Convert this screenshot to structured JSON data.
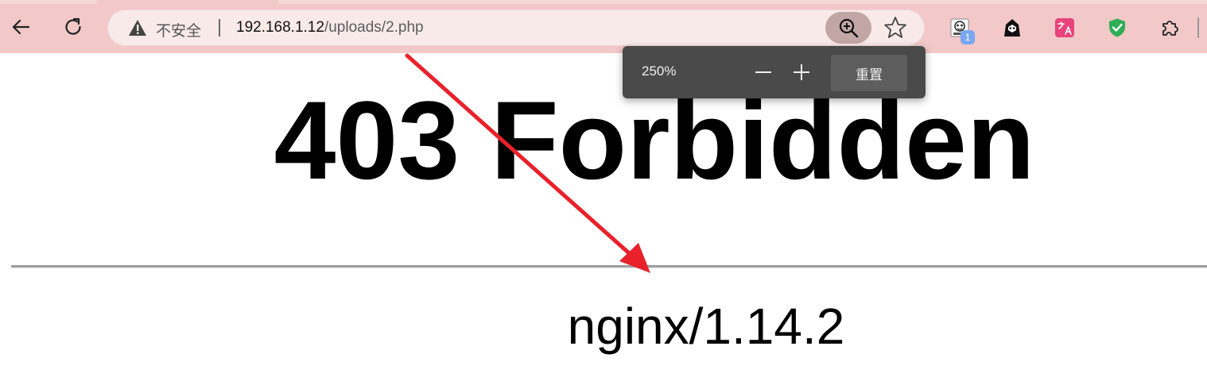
{
  "browser": {
    "security_label": "不安全",
    "url_host": "192.168.1.12",
    "url_path": "/uploads/2.php",
    "extension_badge": "1",
    "icons": [
      "back-icon",
      "reload-icon",
      "warning-icon",
      "zoom-in-icon",
      "star-icon",
      "extension-avatar-icon",
      "extension-hacker-icon",
      "translate-icon",
      "shield-check-icon",
      "puzzle-icon"
    ]
  },
  "zoom_popup": {
    "level": "250%",
    "reset_label": "重置"
  },
  "page": {
    "title": "403 Forbidden",
    "server": "nginx/1.14.2"
  },
  "annotation": {
    "arrow_color": "#e8212b"
  }
}
